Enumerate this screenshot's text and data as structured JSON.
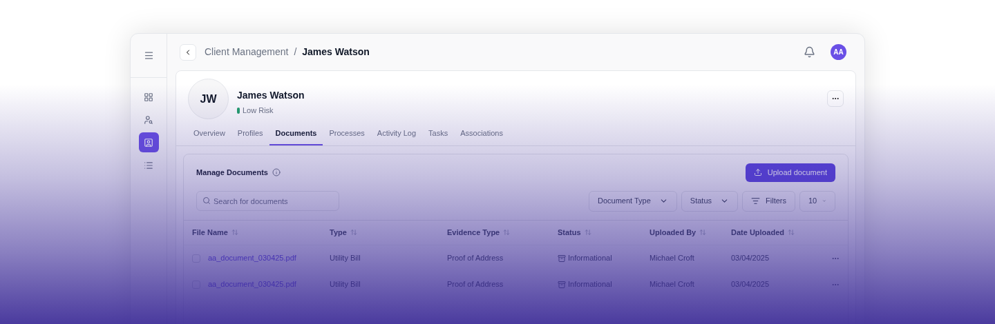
{
  "sidebar": {
    "items": [
      {
        "kind": "dashboard",
        "selected": false
      },
      {
        "kind": "clients",
        "selected": false
      },
      {
        "kind": "contacts",
        "selected": true
      },
      {
        "kind": "list",
        "selected": false
      }
    ]
  },
  "header": {
    "breadcrumb": [
      "Client Management",
      "James Watson"
    ],
    "separator": "/",
    "avatar": "AA"
  },
  "client": {
    "initials": "JW",
    "name": "James Watson",
    "risk": "Low Risk"
  },
  "tabs": [
    {
      "label": "Overview",
      "selected": false
    },
    {
      "label": "Profiles",
      "selected": false
    },
    {
      "label": "Documents",
      "selected": true
    },
    {
      "label": "Processes",
      "selected": false
    },
    {
      "label": "Activity Log",
      "selected": false
    },
    {
      "label": "Tasks",
      "selected": false
    },
    {
      "label": "Associations",
      "selected": false
    }
  ],
  "documents": {
    "title": "Manage Documents",
    "upload_button": "Upload document",
    "search": {
      "placeholder": "Search for documents"
    },
    "filters": [
      {
        "label": "Document Type",
        "kind": "dropdown"
      },
      {
        "label": "Status",
        "kind": "dropdown"
      },
      {
        "label": "Filters",
        "kind": "filter"
      },
      {
        "label": "10",
        "kind": "dropdown"
      }
    ],
    "table": {
      "columns": [
        "File Name",
        "Type",
        "Evidence Type",
        "Status",
        "Uploaded By",
        "Date Uploaded"
      ],
      "rows": [
        {
          "checked": false,
          "file_name": "aa_document_030425.pdf",
          "type": "Utility Bill",
          "evidence_type": "Proof of Address",
          "status": "Informational",
          "uploaded_by": "Michael Croft",
          "date_uploaded": "03/04/2025"
        },
        {
          "checked": false,
          "file_name": "aa_document_030425.pdf",
          "type": "Utility Bill",
          "evidence_type": "Proof of Address",
          "status": "Informational",
          "uploaded_by": "Michael Croft",
          "date_uploaded": "03/04/2025"
        }
      ]
    }
  }
}
